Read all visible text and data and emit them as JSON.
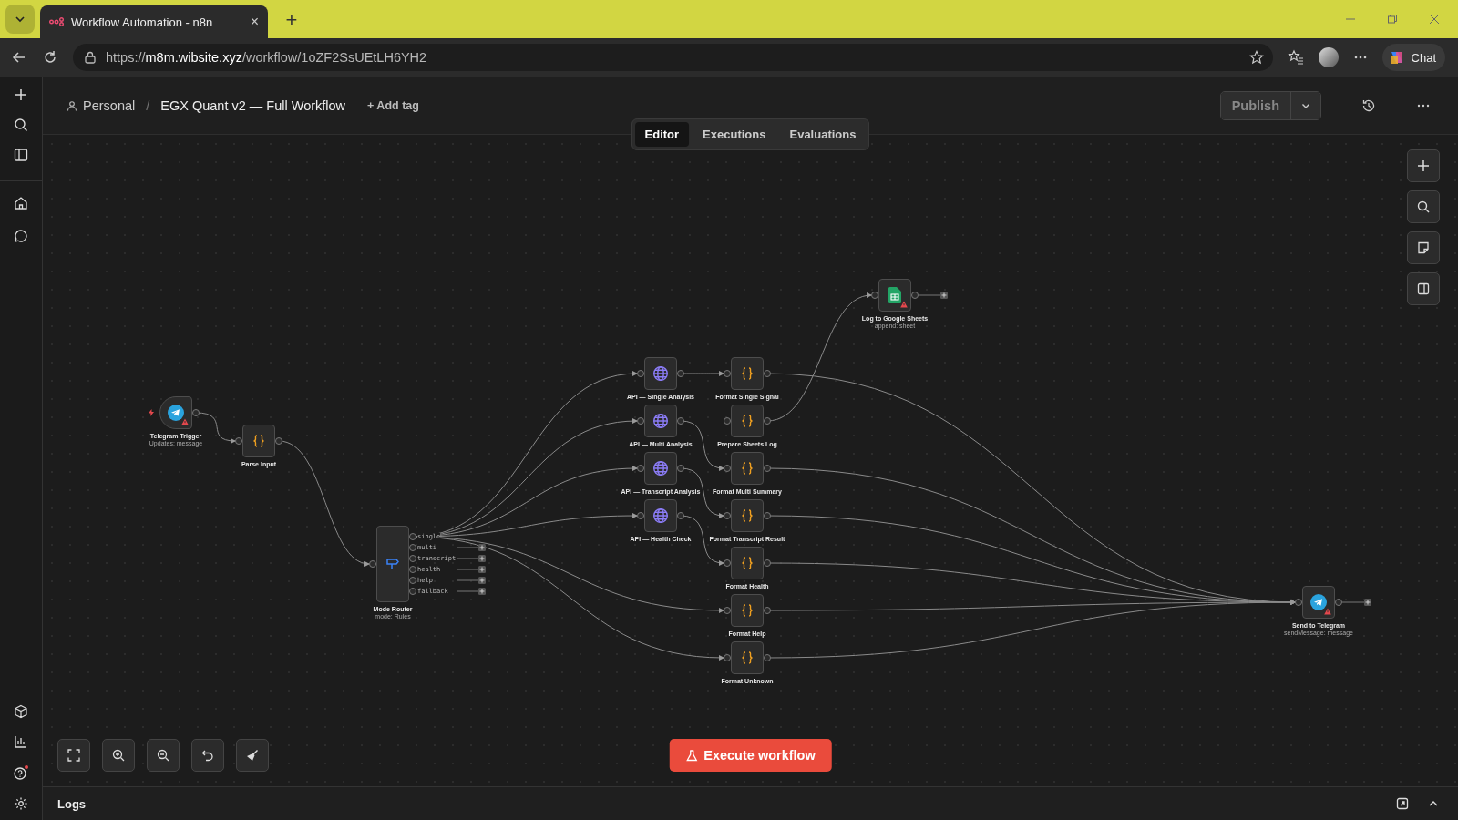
{
  "browser": {
    "tab": {
      "title": "Workflow Automation - n8n",
      "close": "×"
    },
    "new_tab": "+",
    "url": {
      "scheme": "https://",
      "host": "m8m.wibsite.xyz",
      "path": "/workflow/1oZF2SsUEtLH6YH2"
    },
    "chat_button": "Chat"
  },
  "header": {
    "project": "Personal",
    "separator": "/",
    "workflow_name": "EGX Quant v2 — Full Workflow",
    "add_tag": "+ Add tag",
    "publish": "Publish"
  },
  "view_tabs": [
    {
      "label": "Editor",
      "selected": true
    },
    {
      "label": "Executions",
      "selected": false
    },
    {
      "label": "Evaluations",
      "selected": false
    }
  ],
  "nodes": [
    {
      "kind": "trigger",
      "label": "Telegram Trigger",
      "subtitle": "Updates: message",
      "warning": true
    },
    {
      "kind": "code",
      "label": "Parse Input",
      "warning": false
    },
    {
      "kind": "router",
      "label": "Mode Router",
      "subtitle": "mode: Rules",
      "warning": false,
      "outputs": [
        "single",
        "multi",
        "transcript",
        "health",
        "help",
        "fallback"
      ]
    },
    {
      "kind": "http",
      "label": "API — Single Analysis",
      "warning": false
    },
    {
      "kind": "http",
      "label": "API — Multi Analysis",
      "warning": false
    },
    {
      "kind": "http",
      "label": "API — Transcript Analysis",
      "warning": false
    },
    {
      "kind": "http",
      "label": "API — Health Check",
      "warning": false
    },
    {
      "kind": "code",
      "label": "Format Single Signal",
      "warning": false
    },
    {
      "kind": "code",
      "label": "Prepare Sheets Log",
      "warning": false
    },
    {
      "kind": "code",
      "label": "Format Multi Summary",
      "warning": false
    },
    {
      "kind": "code",
      "label": "Format Transcript Result",
      "warning": false
    },
    {
      "kind": "code",
      "label": "Format Health",
      "warning": false
    },
    {
      "kind": "code",
      "label": "Format Help",
      "warning": false
    },
    {
      "kind": "code",
      "label": "Format Unknown",
      "warning": false
    },
    {
      "kind": "sheets",
      "label": "Log to Google Sheets",
      "subtitle": "append: sheet",
      "warning": true
    },
    {
      "kind": "telegram",
      "label": "Send to Telegram",
      "subtitle": "sendMessage: message",
      "warning": true
    }
  ],
  "execute_button": "Execute workflow",
  "logs": {
    "title": "Logs"
  }
}
